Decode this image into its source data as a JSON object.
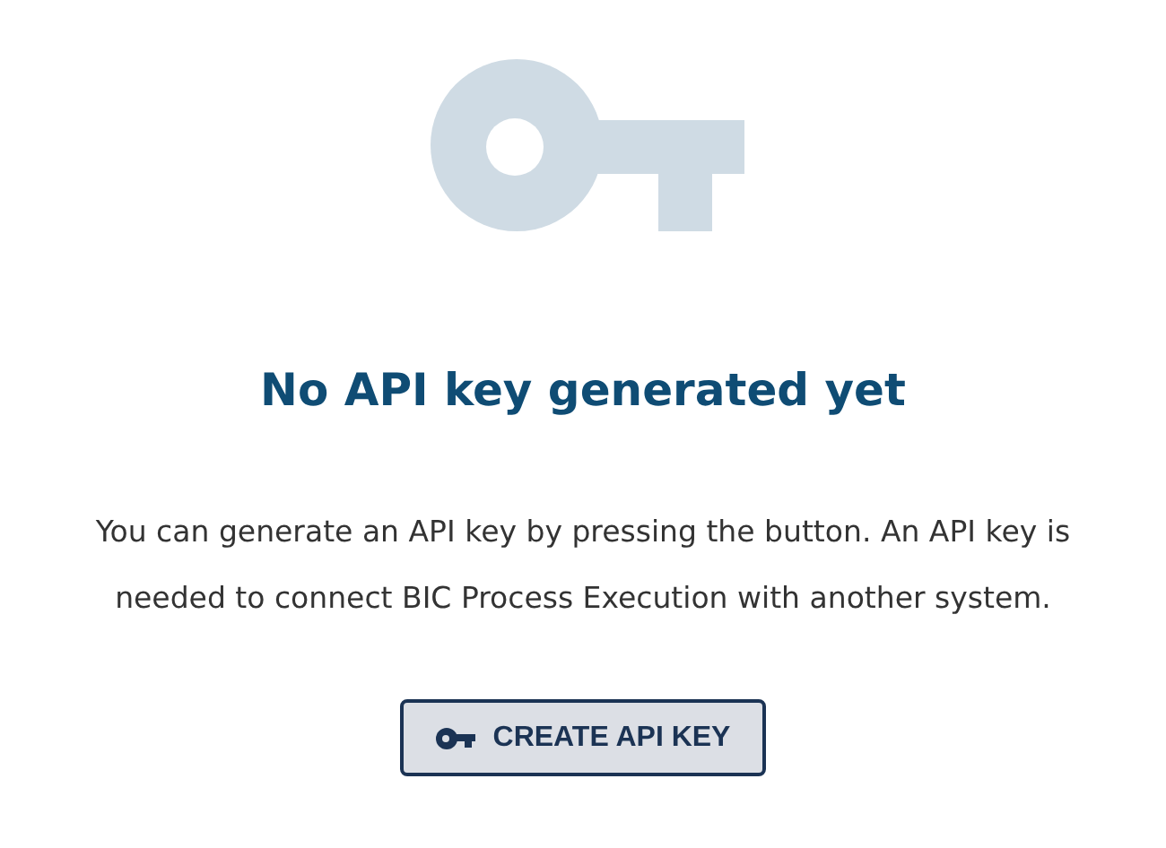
{
  "heading": "No API key generated yet",
  "message": "You can generate an API key by pressing the button. An API key is needed to connect BIC Process Execution with another system.",
  "button": {
    "label": "CREATE API KEY"
  }
}
